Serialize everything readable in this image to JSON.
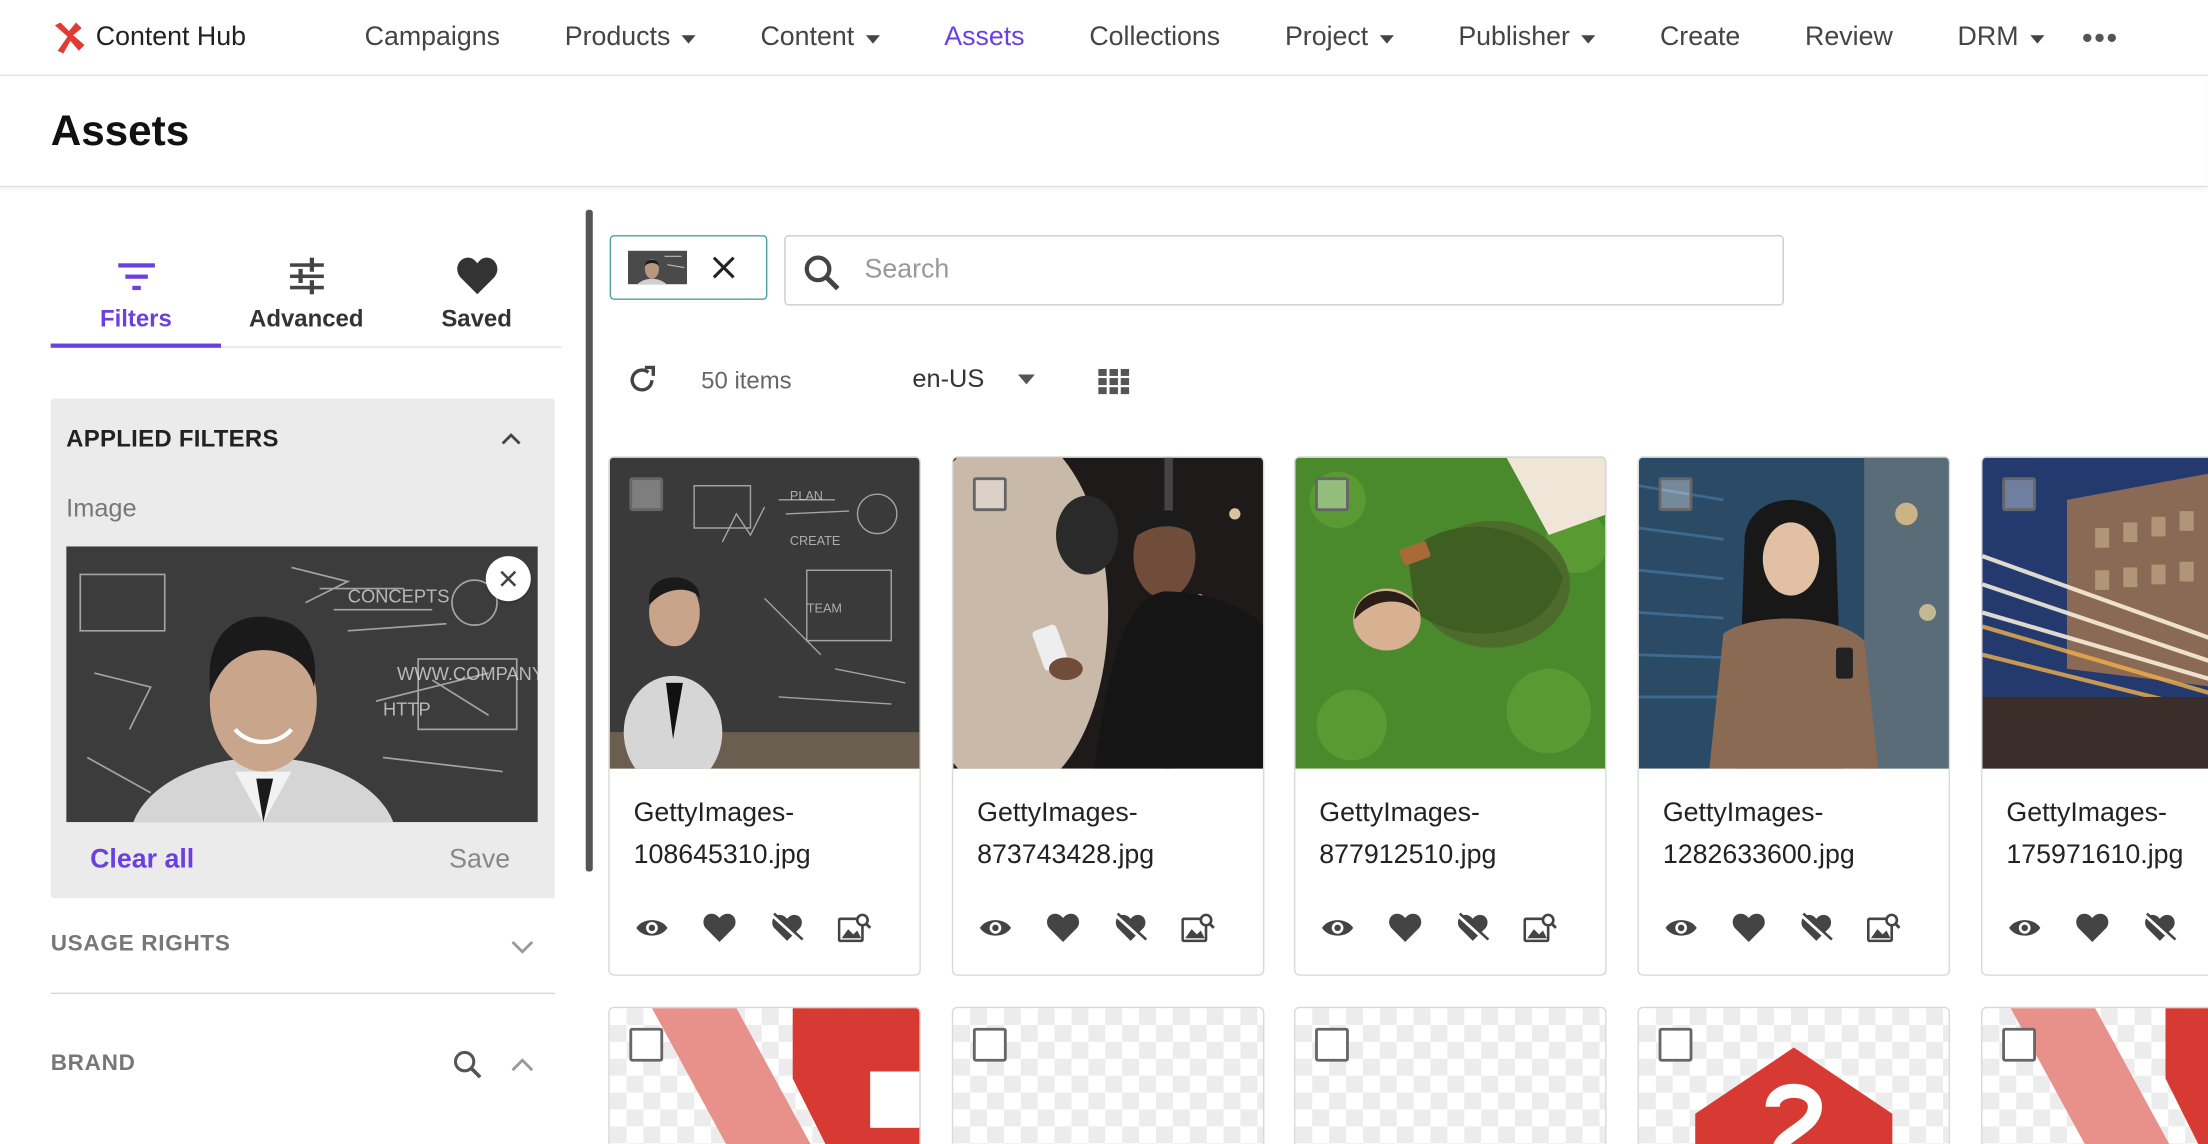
{
  "brand": {
    "name": "Content Hub",
    "logo_color": "#e03b35"
  },
  "nav": {
    "items": [
      {
        "label": "Campaigns",
        "dropdown": false,
        "active": false
      },
      {
        "label": "Products",
        "dropdown": true,
        "active": false
      },
      {
        "label": "Content",
        "dropdown": true,
        "active": false
      },
      {
        "label": "Assets",
        "dropdown": false,
        "active": true
      },
      {
        "label": "Collections",
        "dropdown": false,
        "active": false
      },
      {
        "label": "Project",
        "dropdown": true,
        "active": false
      },
      {
        "label": "Publisher",
        "dropdown": true,
        "active": false
      },
      {
        "label": "Create",
        "dropdown": false,
        "active": false
      },
      {
        "label": "Review",
        "dropdown": false,
        "active": false
      },
      {
        "label": "DRM",
        "dropdown": true,
        "active": false
      }
    ],
    "more": "•••",
    "accent": "#6b3fe0"
  },
  "page": {
    "title": "Assets"
  },
  "sidebar": {
    "tabs": [
      {
        "label": "Filters",
        "icon": "filter-icon",
        "active": true
      },
      {
        "label": "Advanced",
        "icon": "sliders-icon",
        "active": false
      },
      {
        "label": "Saved",
        "icon": "heart-icon",
        "active": false
      }
    ],
    "applied": {
      "title": "APPLIED FILTERS",
      "sub": "Image",
      "clear_label": "Clear all",
      "save_label": "Save"
    },
    "facets": [
      {
        "label": "USAGE RIGHTS",
        "expanded": false,
        "searchable": false
      },
      {
        "label": "BRAND",
        "expanded": true,
        "searchable": true
      }
    ]
  },
  "search": {
    "placeholder": "Search",
    "value": ""
  },
  "toolbar": {
    "count": "50 items",
    "locale": "en-US"
  },
  "assets": [
    {
      "name": "GettyImages-108645310.jpg"
    },
    {
      "name": "GettyImages-873743428.jpg"
    },
    {
      "name": "GettyImages-877912510.jpg"
    },
    {
      "name": "GettyImages-1282633600.jpg"
    },
    {
      "name": "GettyImages-175971610.jpg"
    }
  ],
  "asset_actions": [
    "eye-icon",
    "heart-icon",
    "heart-broken-icon",
    "image-search-icon"
  ]
}
